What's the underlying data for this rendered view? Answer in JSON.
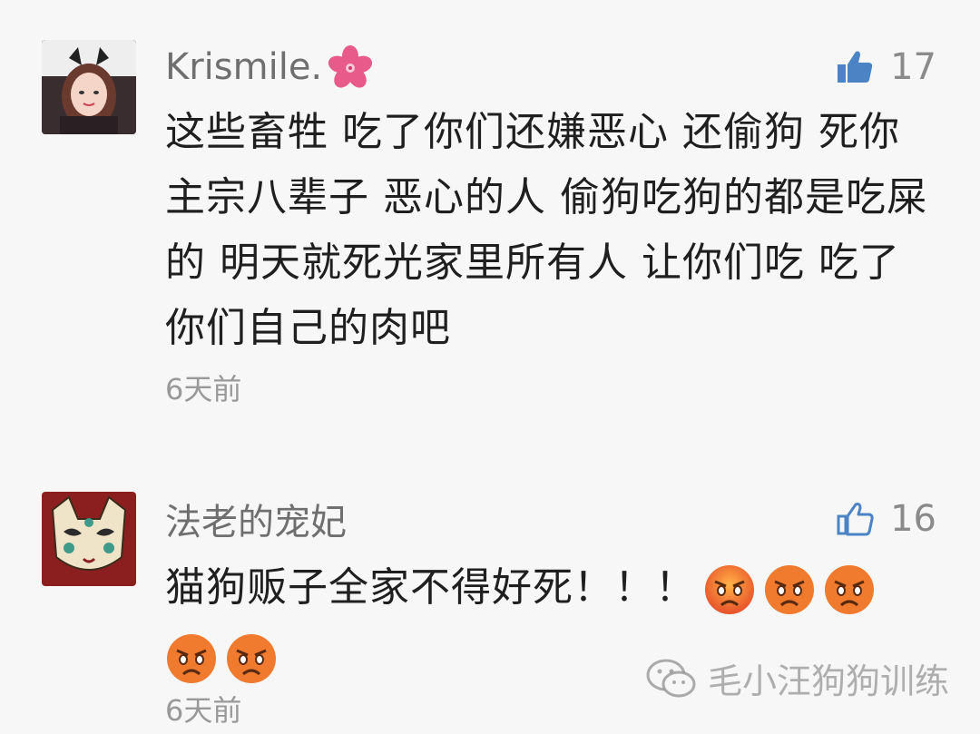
{
  "comments": [
    {
      "username": "Krismile.",
      "username_flower": "flower-icon",
      "likes": "17",
      "text": "这些畜牲 吃了你们还嫌恶心 还偷狗 死你主宗八辈子 恶心的人 偷狗吃狗的都是吃屎的 明天就死光家里所有人 让你们吃 吃了你们自己的肉吧",
      "time": "6天前"
    },
    {
      "username": "法老的宠妃",
      "likes": "16",
      "text": "猫狗贩子全家不得好死！！！",
      "emoji_count": 5,
      "time": "6天前"
    }
  ],
  "watermark": {
    "text": "毛小汪狗狗训练"
  },
  "colors": {
    "like_icon": "#4b83c4",
    "background": "#f7f7f7",
    "flower": "#e85a8a"
  }
}
